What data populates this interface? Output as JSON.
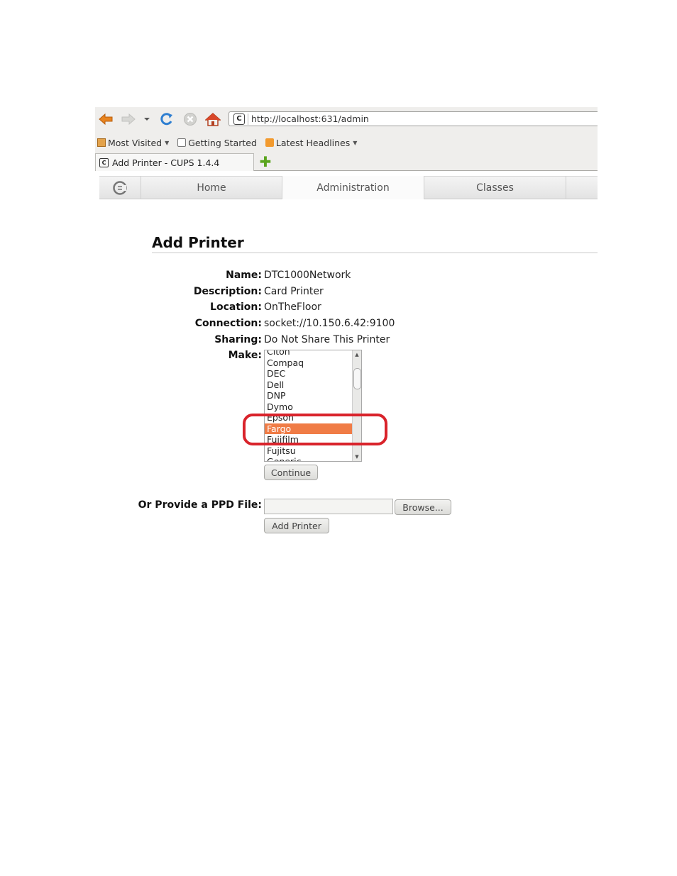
{
  "browser": {
    "url": "http://localhost:631/admin",
    "bookmarks": [
      {
        "label": "Most Visited",
        "icon": "folder-icon",
        "dropdown": true
      },
      {
        "label": "Getting Started",
        "icon": "page-icon",
        "dropdown": false
      },
      {
        "label": "Latest Headlines",
        "icon": "rss-icon",
        "dropdown": true
      }
    ],
    "tab_title": "Add Printer - CUPS 1.4.4"
  },
  "cups_nav": {
    "tabs": [
      "Home",
      "Administration",
      "Classes"
    ],
    "active": "Administration"
  },
  "page": {
    "title": "Add Printer",
    "fields": {
      "name_label": "Name:",
      "name_value": "DTC1000Network",
      "description_label": "Description:",
      "description_value": "Card Printer",
      "location_label": "Location:",
      "location_value": "OnTheFloor",
      "connection_label": "Connection:",
      "connection_value": "socket://10.150.6.42:9100",
      "sharing_label": "Sharing:",
      "sharing_value": "Do Not Share This Printer",
      "make_label": "Make:"
    },
    "make_options": [
      "Citoh",
      "Compaq",
      "DEC",
      "Dell",
      "DNP",
      "Dymo",
      "Epson",
      "Fargo",
      "Fujifilm",
      "Fujitsu",
      "Generic"
    ],
    "make_selected": "Fargo",
    "continue_label": "Continue",
    "ppd_label": "Or Provide a PPD File:",
    "browse_label": "Browse...",
    "add_printer_label": "Add Printer"
  },
  "colors": {
    "selected_option": "#f07c46",
    "highlight_ring": "#d9232b"
  }
}
